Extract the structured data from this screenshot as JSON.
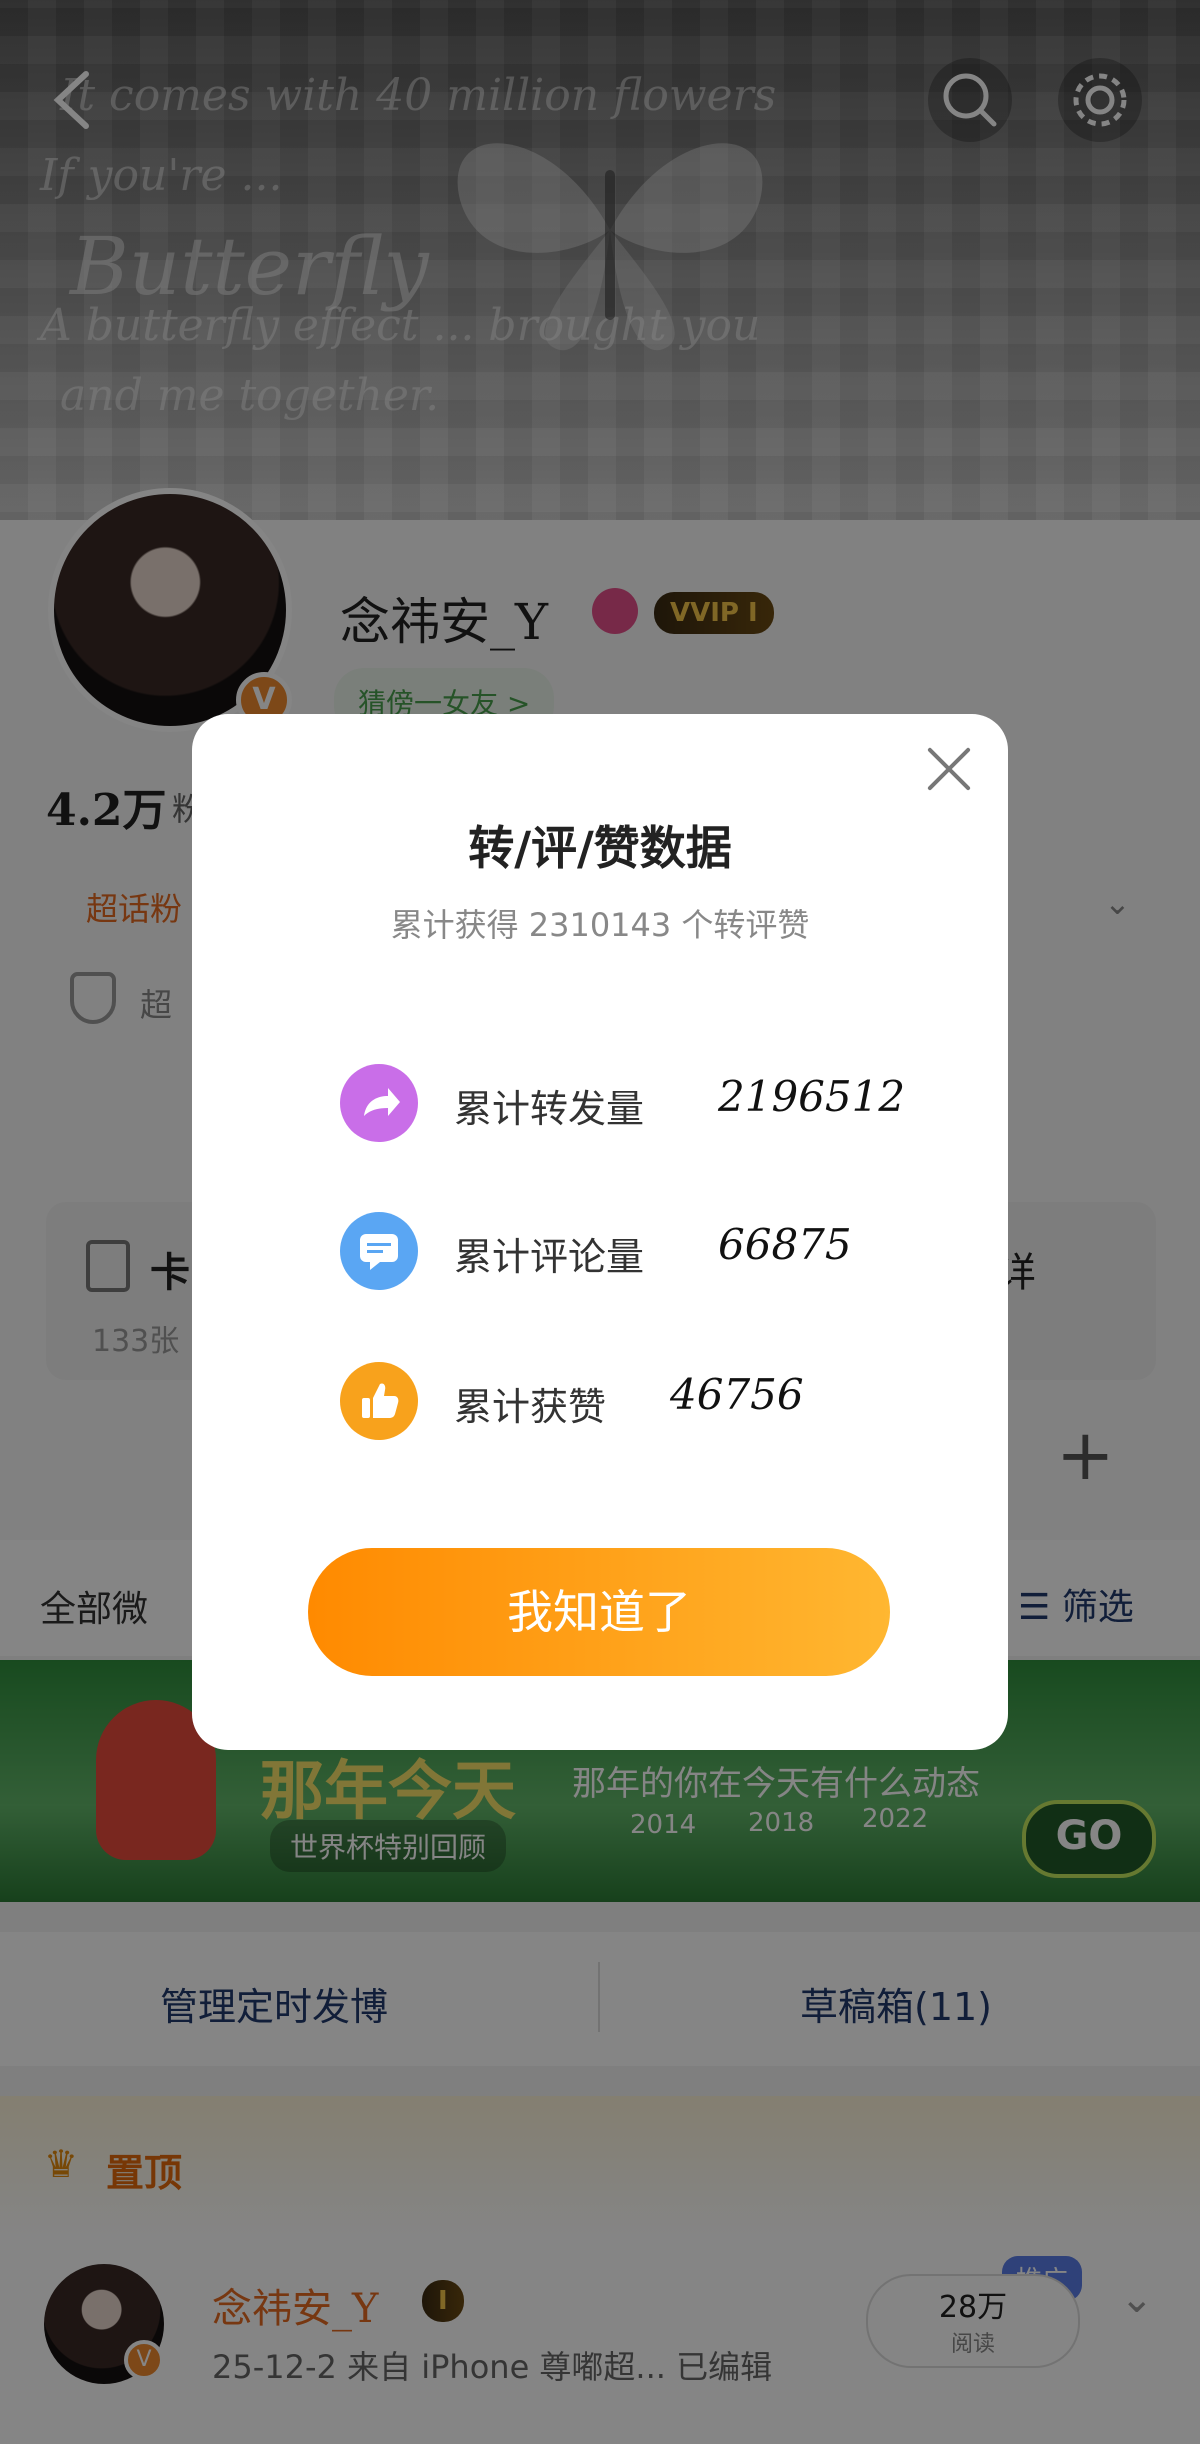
{
  "header": {
    "script_lines": [
      "It comes with 40 million flowers",
      "If you're ...",
      "Butterfly",
      "A butterfly effect ... brought you",
      "and me together."
    ]
  },
  "profile": {
    "name": "念祎安_Y",
    "vip_badge": "VVIP I",
    "verified_badge": "V",
    "friend_pill": "猜傍一女友 >",
    "fans_count": "4.2万",
    "fans_label": "粉",
    "superchat_label": "超话粉",
    "shield_label": "超",
    "cards_label": "卡",
    "cards_count": "133张",
    "right_fragment": "详",
    "plus": "+"
  },
  "filter_bar": {
    "all_label": "全部微",
    "filter_label": "筛选"
  },
  "banner": {
    "title_fragment": "那年今天",
    "subtitle": "那年的你在今天有什么动态",
    "tag": "世界杯特别回顾",
    "years": [
      "2014",
      "2018",
      "2022"
    ],
    "go": "GO"
  },
  "tabs2": {
    "scheduled": "管理定时发博",
    "drafts": "草稿箱(11)"
  },
  "pinned": {
    "label": "置顶",
    "name": "念祎安_Y",
    "vip": "I",
    "meta": "25-12-2  来自 iPhone 尊嘟超...  已编辑",
    "promo": "推广",
    "reads": "28万",
    "reads_label": "阅读"
  },
  "modal": {
    "title": "转/评/赞数据",
    "subtitle": "累计获得 2310143 个转评赞",
    "rows": [
      {
        "label": "累计转发量",
        "value": "2196512",
        "color": "#c96ee8",
        "icon": "share-icon"
      },
      {
        "label": "累计评论量",
        "value": "66875",
        "color": "#5aa6f3",
        "icon": "comment-icon"
      },
      {
        "label": "累计获赞",
        "value": "46756",
        "color": "#f8a21c",
        "icon": "thumbs-up-icon"
      }
    ],
    "ok_button": "我知道了"
  },
  "colors": {
    "accent_orange": "#ff8a00",
    "accent_orange_end": "#ffb731"
  }
}
